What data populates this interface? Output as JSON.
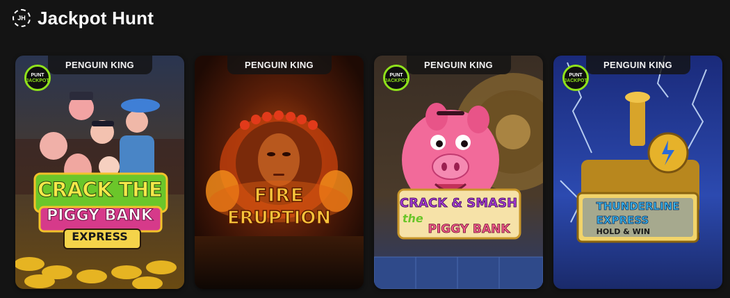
{
  "header": {
    "icon_label": "JH",
    "title": "Jackpot Hunt"
  },
  "colors": {
    "background": "#141414",
    "badge_accent": "#8fe21b"
  },
  "games": [
    {
      "provider": "PENGUIN KING",
      "badge": {
        "line1": "PUNT",
        "line2": "JACKPOT"
      },
      "logo": {
        "line1": "CRACK THE",
        "line2": "PIGGY BANK",
        "line3": "EXPRESS"
      }
    },
    {
      "provider": "PENGUIN KING",
      "logo": {
        "line1": "FIRE",
        "line2": "ERUPTION"
      }
    },
    {
      "provider": "PENGUIN KING",
      "badge": {
        "line1": "PUNT",
        "line2": "JACKPOT"
      },
      "logo": {
        "line1": "CRACK & SMASH",
        "line2": "the",
        "line3": "PIGGY BANK"
      }
    },
    {
      "provider": "PENGUIN KING",
      "badge": {
        "line1": "PUNT",
        "line2": "JACKPOT"
      },
      "logo": {
        "line1": "THUNDERLINE",
        "line2": "EXPRESS",
        "line3": "HOLD & WIN"
      }
    }
  ]
}
